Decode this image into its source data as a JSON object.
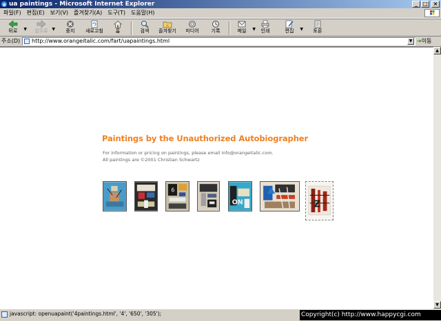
{
  "window": {
    "title": "ua paintings - Microsoft Internet Explorer",
    "controls": {
      "minimize": "_",
      "maximize": "□",
      "close": "×"
    }
  },
  "menu": [
    "파일(F)",
    "편집(E)",
    "보기(V)",
    "즐겨찾기(A)",
    "도구(T)",
    "도움말(H)"
  ],
  "toolbar": {
    "back": "뒤로",
    "forward": "앞으로",
    "stop": "중지",
    "refresh": "새로고침",
    "home": "홈",
    "search": "검색",
    "favorites": "즐겨찾기",
    "media": "미디어",
    "history": "기록",
    "mail": "메일",
    "print": "인쇄",
    "edit": "편집",
    "discuss": "토론"
  },
  "address": {
    "label": "주소(D)",
    "url": "http://www.orangeitalic.com/fart/uapaintings.html",
    "go": "이동"
  },
  "page": {
    "heading": "Paintings by the Unauthorized Autobiographer",
    "info_line1": "For information or pricing on paintings, please email info@orangeitalic.com.",
    "info_line2": "All paintings are ©2001 Christian Schwartz",
    "thumbnails": [
      {
        "name": "painting-thumbnail-1",
        "bg": "#4a9cc8"
      },
      {
        "name": "painting-thumbnail-2",
        "bg": "#2a2a2a"
      },
      {
        "name": "painting-thumbnail-3",
        "bg": "#c8c0a8"
      },
      {
        "name": "painting-thumbnail-4",
        "bg": "#d8d0c0"
      },
      {
        "name": "painting-thumbnail-5",
        "bg": "#38a8c8"
      },
      {
        "name": "painting-thumbnail-6",
        "bg": "#e8e0d0"
      },
      {
        "name": "painting-thumbnail-7",
        "bg": "#f0e8e0"
      }
    ]
  },
  "status": {
    "text": "javascript: openuapaint('4paintings.html', '4', '650', '305');",
    "copyright": "Copyright(c) http://www.happycgi.com"
  },
  "colors": {
    "heading": "#f08020",
    "titlebar_start": "#0a246a",
    "titlebar_end": "#a6caf0"
  }
}
